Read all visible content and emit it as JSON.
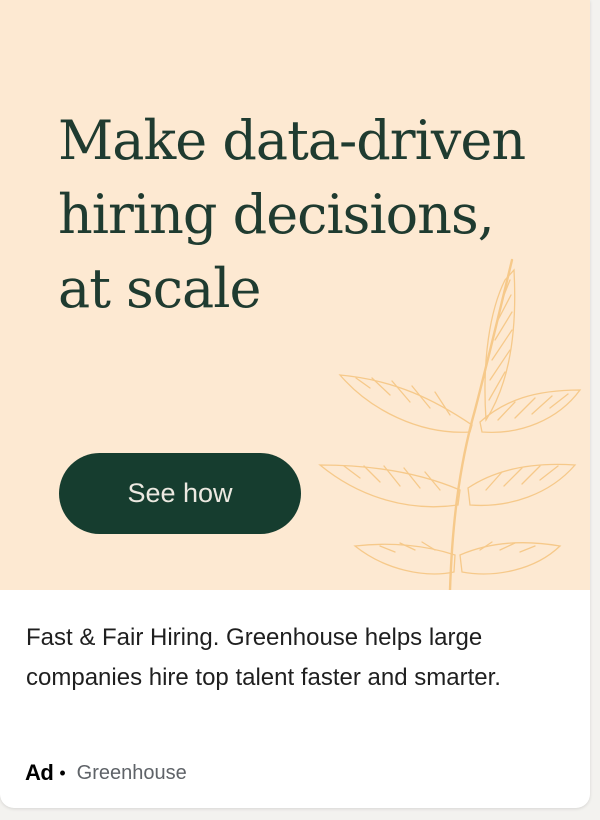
{
  "colors": {
    "banner_background": "#fde9d2",
    "headline_text": "#1f3b30",
    "button_background": "#163d2f",
    "button_text": "#ece9e1",
    "leaf_art": "#f6c98a",
    "body_text": "#1f1f1f",
    "meta_text": "#5f6368"
  },
  "banner": {
    "headline_lines": [
      "Make data-driven",
      "hiring decisions,",
      "at scale"
    ],
    "cta_label": "See how",
    "art_icon": "leaf-branch-icon"
  },
  "ad": {
    "description": "Fast & Fair Hiring. Greenhouse helps large companies hire top talent faster and smarter.",
    "label": "Ad",
    "separator": "•",
    "advertiser": "Greenhouse"
  }
}
